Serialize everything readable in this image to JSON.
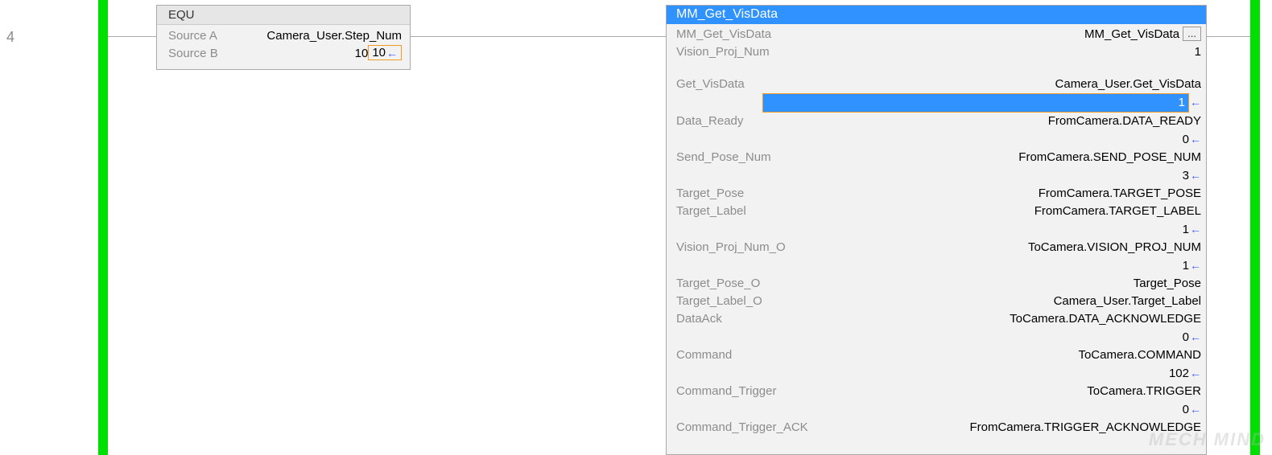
{
  "rung_number": "4",
  "equ": {
    "title": "EQU",
    "sourceA_label": "Source A",
    "sourceA_value": "Camera_User.Step_Num",
    "sourceA_live": "10",
    "sourceB_label": "Source B",
    "sourceB_value": "10"
  },
  "aoi": {
    "title": "MM_Get_VisData",
    "instance_label": "MM_Get_VisData",
    "instance_value": "MM_Get_VisData",
    "ellipsis": "...",
    "rows": [
      {
        "label": "Vision_Proj_Num",
        "value": "1",
        "live": null
      },
      {
        "spacer": true
      },
      {
        "label": "Get_VisData",
        "value": "Camera_User.Get_VisData",
        "live": "1",
        "highlighted": true
      },
      {
        "label": "Data_Ready",
        "value": "FromCamera.DATA_READY",
        "live": "0"
      },
      {
        "label": "Send_Pose_Num",
        "value": "FromCamera.SEND_POSE_NUM",
        "live": "3"
      },
      {
        "label": "Target_Pose",
        "value": "FromCamera.TARGET_POSE",
        "live": null
      },
      {
        "label": "Target_Label",
        "value": "FromCamera.TARGET_LABEL",
        "live": "1"
      },
      {
        "label": "Vision_Proj_Num_O",
        "value": "ToCamera.VISION_PROJ_NUM",
        "live": "1"
      },
      {
        "label": "Target_Pose_O",
        "value": "Target_Pose",
        "live": null
      },
      {
        "label": "Target_Label_O",
        "value": "Camera_User.Target_Label",
        "live": null
      },
      {
        "label": "DataAck",
        "value": "ToCamera.DATA_ACKNOWLEDGE",
        "live": "0"
      },
      {
        "label": "Command",
        "value": "ToCamera.COMMAND",
        "live": "102"
      },
      {
        "label": "Command_Trigger",
        "value": "ToCamera.TRIGGER",
        "live": "0"
      },
      {
        "label": "Command_Trigger_ACK",
        "value": "FromCamera.TRIGGER_ACKNOWLEDGE",
        "live": null
      }
    ]
  },
  "watermark": "MECH MIND"
}
